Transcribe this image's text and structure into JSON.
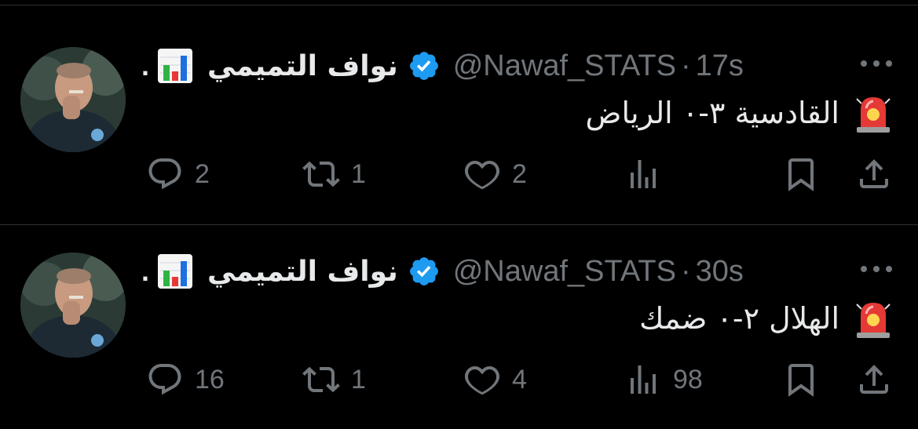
{
  "tweets": [
    {
      "author_name": "نواف التميمي",
      "lead_dot": ".",
      "handle": "@Nawaf_STATS",
      "separator": "·",
      "time": "17s",
      "text": "القادسية ٣-٠ الرياض",
      "replies": "2",
      "retweets": "1",
      "likes": "2",
      "views": ""
    },
    {
      "author_name": "نواف التميمي",
      "lead_dot": ".",
      "handle": "@Nawaf_STATS",
      "separator": "·",
      "time": "30s",
      "text": "الهلال ٢-٠ ضمك",
      "replies": "16",
      "retweets": "1",
      "likes": "4",
      "views": "98"
    }
  ],
  "icons": {
    "name_emoji": "bar-chart-icon",
    "verified": "verified-badge-icon",
    "content_emoji": "police-siren-icon",
    "reply": "reply-icon",
    "retweet": "retweet-icon",
    "like": "heart-icon",
    "views": "views-icon",
    "bookmark": "bookmark-icon",
    "share": "share-icon",
    "more": "more-icon"
  },
  "colors": {
    "background": "#000000",
    "text": "#e7e9ea",
    "muted": "#71767b",
    "verified": "#1d9bf0",
    "divider": "#2f3336"
  }
}
